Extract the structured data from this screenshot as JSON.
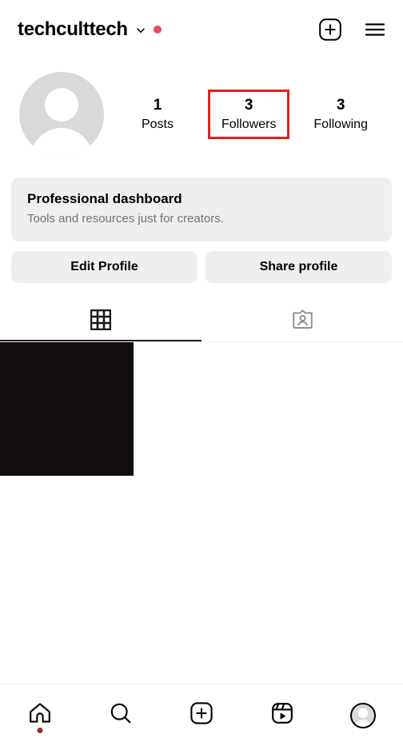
{
  "header": {
    "username": "techculttech",
    "chevron_icon": "chevron-down-icon",
    "badge_dot_color": "#ED4956",
    "create_icon": "plus-square-icon",
    "menu_icon": "hamburger-menu-icon"
  },
  "profile": {
    "avatar_icon": "default-avatar-icon",
    "stats": [
      {
        "value": "1",
        "label": "Posts",
        "highlighted": false
      },
      {
        "value": "3",
        "label": "Followers",
        "highlighted": true
      },
      {
        "value": "3",
        "label": "Following",
        "highlighted": false
      }
    ],
    "highlight_color": "#e02020"
  },
  "dashboard": {
    "title": "Professional dashboard",
    "subtitle": "Tools and resources just for creators."
  },
  "actions": {
    "edit_profile_label": "Edit Profile",
    "share_profile_label": "Share profile"
  },
  "tabs": [
    {
      "name": "posts",
      "icon": "grid-icon",
      "active": true
    },
    {
      "name": "tagged",
      "icon": "tagged-person-card-icon",
      "active": false
    }
  ],
  "grid": {
    "posts": [
      {
        "thumbnail_color": "#120d0f"
      }
    ]
  },
  "bottom_nav": [
    {
      "name": "home",
      "icon": "home-icon",
      "badge": true
    },
    {
      "name": "search",
      "icon": "search-icon",
      "badge": false
    },
    {
      "name": "create",
      "icon": "plus-square-icon",
      "badge": false
    },
    {
      "name": "reels",
      "icon": "reels-icon",
      "badge": false
    },
    {
      "name": "profile",
      "icon": "profile-avatar-icon",
      "badge": false
    }
  ]
}
